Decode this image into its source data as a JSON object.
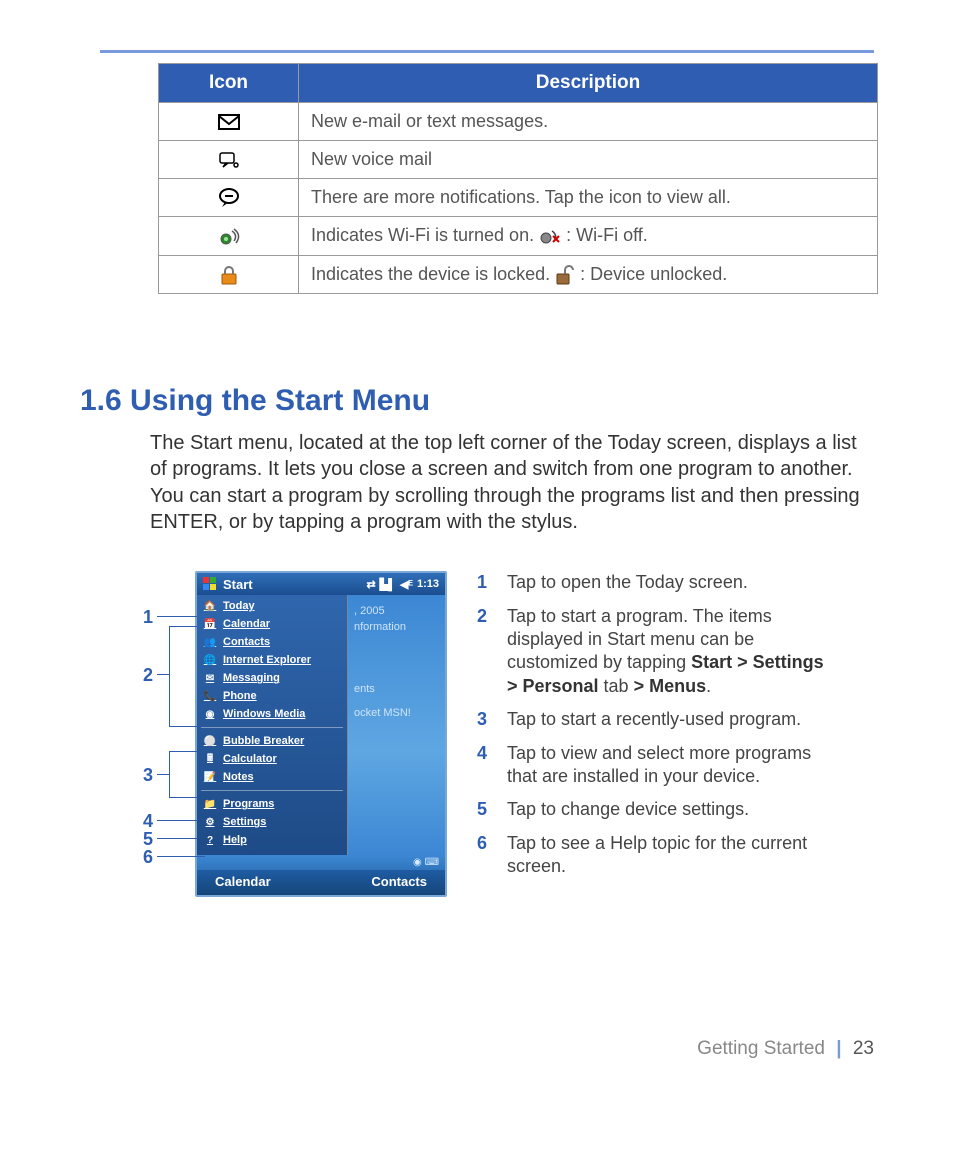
{
  "table": {
    "headers": {
      "icon": "Icon",
      "desc": "Description"
    },
    "rows": [
      {
        "icon": "mail-icon",
        "desc": "New e-mail or text messages."
      },
      {
        "icon": "voicemail-icon",
        "desc": "New voice mail"
      },
      {
        "icon": "more-notifications-icon",
        "desc": "There are more notifications. Tap the icon to view all."
      },
      {
        "icon": "wifi-on-icon",
        "desc_pre": "Indicates Wi-Fi is turned on.  ",
        "inline_icon": "wifi-off-icon",
        "desc_post": ": Wi-Fi off."
      },
      {
        "icon": "lock-icon",
        "desc_pre": "Indicates the device is locked.  ",
        "inline_icon": "unlock-icon",
        "desc_post": ": Device unlocked."
      }
    ]
  },
  "section": {
    "heading": "1.6  Using the Start Menu",
    "paragraph": "The Start menu, located at the top left corner of the Today screen, displays a list of programs. It lets you close a screen and switch from one program to another. You can start a program by scrolling through the programs list and then pressing ENTER, or by tapping a program with the stylus."
  },
  "device": {
    "topbar": {
      "label": "Start",
      "time": "1:13"
    },
    "menu_groups": [
      [
        {
          "icon": "home-icon",
          "label": "Today"
        },
        {
          "icon": "calendar-icon",
          "label": "Calendar"
        },
        {
          "icon": "contacts-icon",
          "label": "Contacts"
        },
        {
          "icon": "ie-icon",
          "label": "Internet Explorer"
        },
        {
          "icon": "messaging-icon",
          "label": "Messaging"
        },
        {
          "icon": "phone-icon",
          "label": "Phone"
        },
        {
          "icon": "wmp-icon",
          "label": "Windows Media"
        }
      ],
      [
        {
          "icon": "bubble-icon",
          "label": "Bubble Breaker"
        },
        {
          "icon": "calc-icon",
          "label": "Calculator"
        },
        {
          "icon": "notes-icon",
          "label": "Notes"
        }
      ],
      [
        {
          "icon": "programs-icon",
          "label": "Programs"
        },
        {
          "icon": "settings-icon",
          "label": "Settings"
        },
        {
          "icon": "help-icon",
          "label": "Help"
        }
      ]
    ],
    "backplate": {
      "line1": ", 2005",
      "line2": "nformation",
      "line3": "ents",
      "line4": "ocket MSN!"
    },
    "softkeys": {
      "left": "Calendar",
      "right": "Contacts"
    }
  },
  "callouts": {
    "c1": "1",
    "c2": "2",
    "c3": "3",
    "c4": "4",
    "c5": "5",
    "c6": "6"
  },
  "legend": [
    {
      "n": "1",
      "text": "Tap to open the Today screen."
    },
    {
      "n": "2",
      "text_pre": "Tap to start a program. The items displayed in Start menu can be customized by tapping ",
      "bold": "Start > Settings > Personal",
      "mid": " tab ",
      "bold2": "> Menus",
      "post": "."
    },
    {
      "n": "3",
      "text": "Tap to start a recently-used program."
    },
    {
      "n": "4",
      "text": "Tap to view and select more programs that are installed in your device."
    },
    {
      "n": "5",
      "text": "Tap to change device settings."
    },
    {
      "n": "6",
      "text": "Tap to see a Help topic for the current screen."
    }
  ],
  "footer": {
    "section": "Getting Started",
    "page": "23"
  }
}
